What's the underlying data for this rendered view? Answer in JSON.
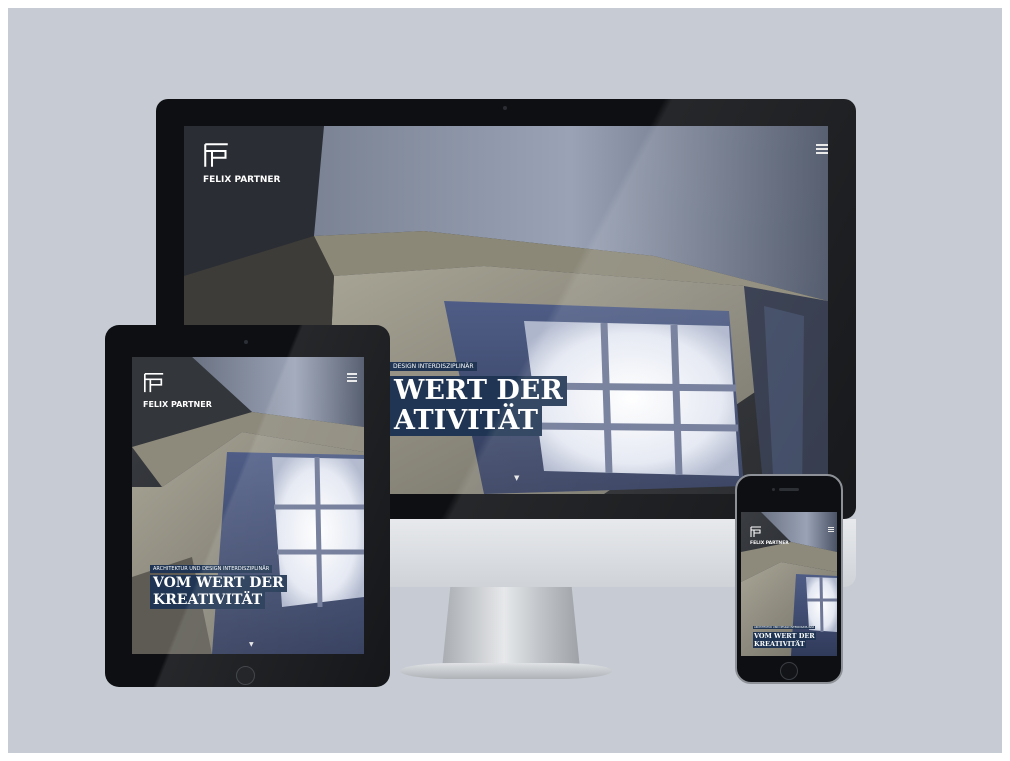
{
  "brand": {
    "logo_text": "FELIX PARTNER"
  },
  "hero": {
    "tagline": "ARCHITEKTUR UND DESIGN INTERDISZIPLINÄR",
    "imac_tagline": "DESIGN INTERDISZIPLINÄR",
    "headline_line1": "VOM WERT DER",
    "headline_line2": "KREATIVITÄT",
    "imac_line1": "WERT DER",
    "imac_line2": "ATIVITÄT",
    "imac_logo_text": "FELIX PARTNER",
    "ipad_logo_text": "FELIX PARTNER"
  },
  "icons": {
    "menu": "hamburger-menu-icon",
    "scroll": "chevron-down-icon",
    "logo": "fp-monogram-icon"
  },
  "colors": {
    "background": "#c7cbd3",
    "device_black": "#0d0f12",
    "headline_box": "#1f3553"
  }
}
